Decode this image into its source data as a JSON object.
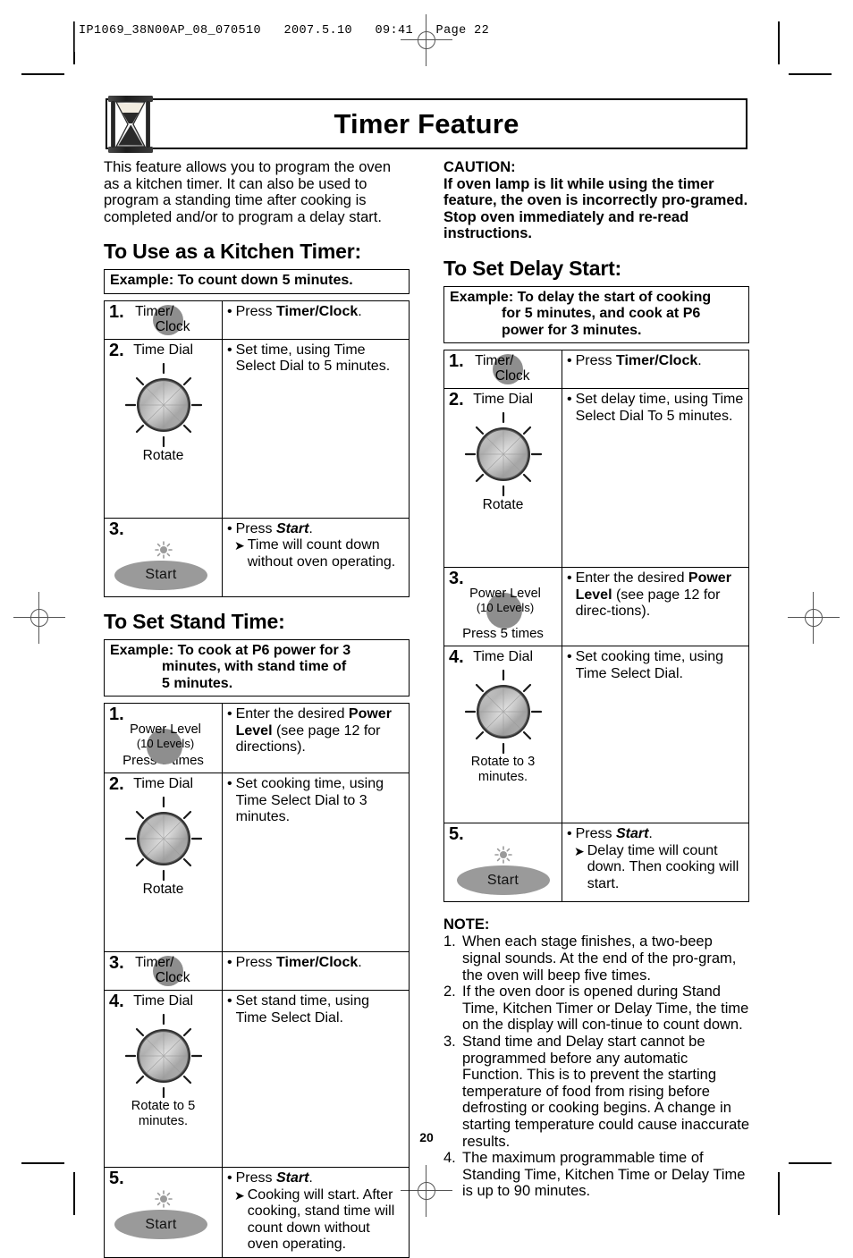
{
  "slug": "IP1069_38N00AP_08_070510   2007.5.10   09:41   Page 22",
  "title": "Timer Feature",
  "intro": "This feature allows you to program the oven as a kitchen timer. It can also be used to program a standing time after cooking is completed and/or to program a delay start.",
  "caution": {
    "head": "CAUTION:",
    "body": "If oven lamp is lit while using the timer feature, the oven is incorrectly pro-gramed. Stop oven immediately and re-read instructions."
  },
  "labels": {
    "timer_clock_l1": "Timer/",
    "timer_clock_l2": "Clock",
    "power_level_l1": "Power Level",
    "power_level_l2": "(10 Levels)",
    "press_5_times": "Press 5 times",
    "time_dial": "Time Dial",
    "rotate": "Rotate",
    "rotate_5": "Rotate to 5 minutes.",
    "rotate_3": "Rotate to 3 minutes.",
    "start": "Start"
  },
  "kitchen_timer": {
    "heading": "To Use  as a Kitchen Timer:",
    "example_line1": "Example: To count down 5 minutes.",
    "steps": [
      {
        "num": "1.",
        "action_bullet": "Press Timer/Clock.",
        "action_pre": "Press ",
        "action_bold": "Timer/Clock",
        "action_post": "."
      },
      {
        "num": "2.",
        "action": "Set time, using Time Select Dial to 5 minutes."
      },
      {
        "num": "3.",
        "action_pre": "Press ",
        "action_bold": "Start",
        "action_post": ".",
        "result": "Time will count down without oven operating."
      }
    ]
  },
  "stand_time": {
    "heading": "To Set Stand Time:",
    "example_line1": "Example: To cook at P6 power for 3",
    "example_line2": "minutes, with stand time of",
    "example_line3": "5 minutes.",
    "steps": [
      {
        "num": "1.",
        "action_pre": "Enter the desired ",
        "action_bold": "Power Level",
        "action_post": " (see page 12 for directions)."
      },
      {
        "num": "2.",
        "action": "Set cooking time, using Time Select Dial to 3 minutes."
      },
      {
        "num": "3.",
        "action_pre": "Press ",
        "action_bold": "Timer/Clock",
        "action_post": "."
      },
      {
        "num": "4.",
        "action": "Set stand time, using Time Select Dial."
      },
      {
        "num": "5.",
        "action_pre": "Press ",
        "action_bold": "Start",
        "action_post": ".",
        "result": "Cooking will start. After cooking, stand time will count down without oven operating."
      }
    ]
  },
  "delay_start": {
    "heading": "To Set Delay Start:",
    "example_line1": "Example: To delay the start of cooking",
    "example_line2": "for 5 minutes, and cook at P6",
    "example_line3": "power for 3 minutes.",
    "steps": [
      {
        "num": "1.",
        "action_pre": "Press ",
        "action_bold": "Timer/Clock",
        "action_post": "."
      },
      {
        "num": "2.",
        "action": "Set delay time, using Time Select Dial To 5 minutes."
      },
      {
        "num": "3.",
        "action_pre": "Enter the desired ",
        "action_bold": "Power Level",
        "action_post": " (see page 12 for direc-tions)."
      },
      {
        "num": "4.",
        "action": "Set cooking time, using Time Select Dial."
      },
      {
        "num": "5.",
        "action_pre": "Press ",
        "action_bold": "Start",
        "action_post": ".",
        "result": "Delay time will count down. Then cooking will start."
      }
    ]
  },
  "notes": {
    "head": "NOTE:",
    "items": [
      {
        "n": "1.",
        "text": "When each stage finishes, a two-beep signal sounds. At the end of the pro-gram, the oven will beep five times."
      },
      {
        "n": "2.",
        "text": "If the oven door is opened during Stand Time, Kitchen Timer or Delay Time, the time on the display will con-tinue to count down."
      },
      {
        "n": "3.",
        "text": "Stand time and Delay start cannot be programmed before any automatic Function. This is to prevent the starting temperature of food from rising before defrosting or cooking begins. A change in starting temperature could cause inaccurate results."
      },
      {
        "n": "4.",
        "text": "The maximum programmable time of Standing Time, Kitchen Time or Delay Time is up to 90 minutes."
      }
    ]
  },
  "page_number": "20",
  "colors": {
    "key_gray": "#8e8e8e",
    "start_gray": "#9a9a9a",
    "rule": "#000000"
  }
}
